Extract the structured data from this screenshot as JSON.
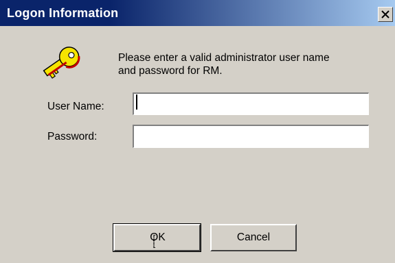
{
  "window": {
    "title": "Logon Information",
    "close_glyph": "✕"
  },
  "icon": {
    "name": "key-icon",
    "color": "#f5e400"
  },
  "message": {
    "text": "Please enter a valid administrator user name and password for RM."
  },
  "form": {
    "username_label": "User Name:",
    "username_value": "",
    "password_label": "Password:",
    "password_value": ""
  },
  "buttons": {
    "ok_label": "OK",
    "cancel_label": "Cancel"
  },
  "colors": {
    "dialog_bg": "#d4d0c8",
    "title_start": "#0a246a",
    "title_end": "#a6caf0"
  }
}
